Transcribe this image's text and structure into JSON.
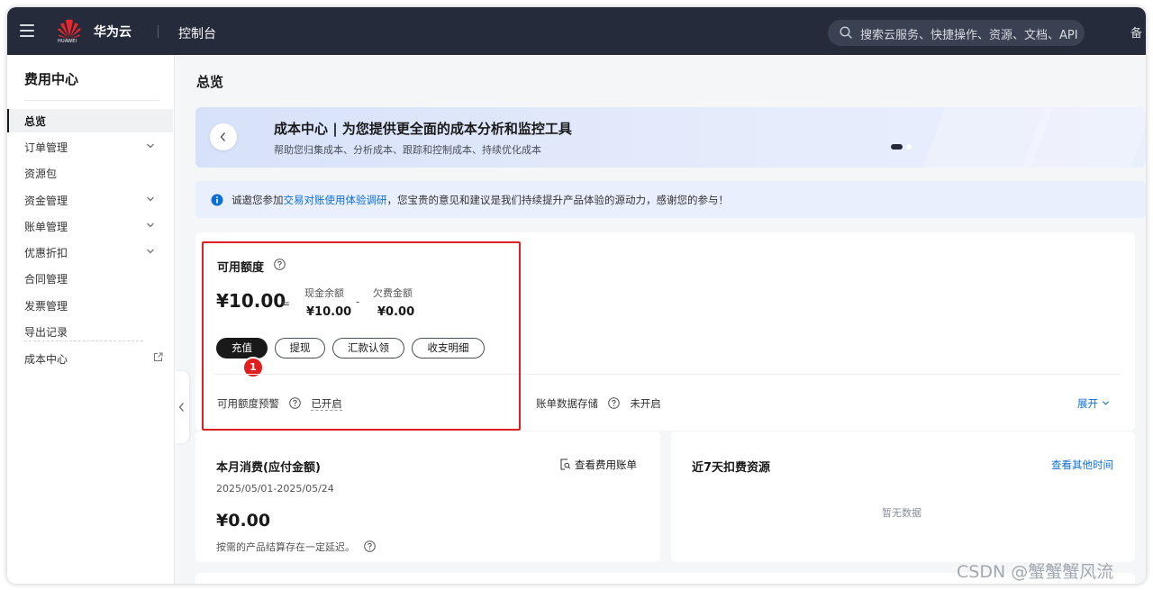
{
  "topbar": {
    "logo_text": "HUAWEI",
    "brand": "华为云",
    "console": "控制台",
    "search_placeholder": "搜索云服务、快捷操作、资源、文档、API",
    "more_label": "备"
  },
  "sidebar": {
    "title": "费用中心",
    "items": [
      {
        "label": "总览",
        "active": true
      },
      {
        "label": "订单管理",
        "expandable": true
      },
      {
        "label": "资源包"
      },
      {
        "label": "资金管理",
        "expandable": true
      },
      {
        "label": "账单管理",
        "expandable": true
      },
      {
        "label": "优惠折扣",
        "expandable": true
      },
      {
        "label": "合同管理"
      },
      {
        "label": "发票管理"
      },
      {
        "label": "导出记录"
      },
      {
        "label": "成本中心",
        "external": true
      }
    ]
  },
  "page": {
    "title": "总览"
  },
  "banner": {
    "title": "成本中心 | 为您提供更全面的成本分析和监控工具",
    "subtitle": "帮助您归集成本、分析成本、跟踪和控制成本、持续优化成本"
  },
  "notice": {
    "prefix": "诚邀您参加",
    "link": "交易对账使用体验调研",
    "suffix": "，您宝贵的意见和建议是我们持续提升产品体验的源动力，感谢您的参与！"
  },
  "available": {
    "label": "可用额度",
    "amount": "¥10.00",
    "equals": "=",
    "cash_label": "现金余额",
    "cash_value": "¥10.00",
    "minus": "-",
    "debt_label": "欠费金额",
    "debt_value": "¥0.00",
    "buttons": {
      "recharge": "充值",
      "withdraw": "提现",
      "remit": "汇款认领",
      "details": "收支明细"
    },
    "step_badge": "1",
    "alert_label": "可用额度预警",
    "alert_status": "已开启",
    "storage_label": "账单数据存储",
    "storage_status": "未开启",
    "expand": "展开"
  },
  "monthly": {
    "title": "本月消费(应付金额)",
    "link": "查看费用账单",
    "date_range": "2025/05/01-2025/05/24",
    "amount": "¥0.00",
    "note": "按需的产品结算存在一定延迟。"
  },
  "recent": {
    "title": "近7天扣费资源",
    "link": "查看其他时间",
    "empty": "暂无数据"
  },
  "watermark": "CSDN @蟹蟹蟹风流",
  "colors": {
    "topbar": "#252b3a",
    "link": "#0d6fd8",
    "highlight": "#e02020",
    "primary_button": "#191919"
  }
}
